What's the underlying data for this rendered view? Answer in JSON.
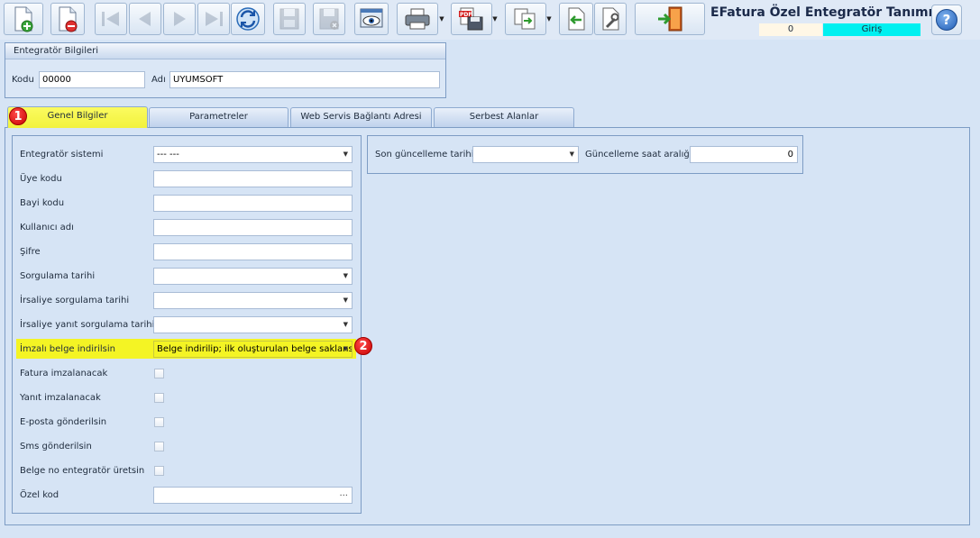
{
  "toolbar": {
    "buttons": [
      {
        "icon": "new-document-icon"
      },
      {
        "icon": "delete-document-icon"
      },
      {
        "icon": "first-record-icon"
      },
      {
        "icon": "previous-record-icon"
      },
      {
        "icon": "next-record-icon"
      },
      {
        "icon": "last-record-icon"
      },
      {
        "icon": "refresh-icon"
      },
      {
        "icon": "save-icon"
      },
      {
        "icon": "save-close-icon"
      },
      {
        "icon": "preview-icon"
      },
      {
        "icon": "print-icon"
      },
      {
        "icon": "pdf-export-icon"
      },
      {
        "icon": "copy-icon"
      },
      {
        "icon": "import-icon"
      },
      {
        "icon": "tools-icon"
      },
      {
        "icon": "exit-icon"
      }
    ],
    "title": "EFatura Özel Entegratör Tanımı",
    "record_count": "0",
    "mode": "Giriş",
    "mode_color": "#00f0f0"
  },
  "integrator_group": {
    "title": "Entegratör Bilgileri",
    "code_label": "Kodu",
    "code_value": "00000",
    "name_label": "Adı",
    "name_value": "UYUMSOFT"
  },
  "tabs": [
    {
      "label": "Genel Bilgiler",
      "active": true
    },
    {
      "label": "Parametreler",
      "active": false
    },
    {
      "label": "Web Servis Bağlantı Adresi",
      "active": false
    },
    {
      "label": "Serbest Alanlar",
      "active": false
    }
  ],
  "general": {
    "system_label": "Entegratör sistemi",
    "system_value": "--- ---",
    "member_code_label": "Üye kodu",
    "dealer_code_label": "Bayi kodu",
    "username_label": "Kullanıcı adı",
    "password_label": "Şifre",
    "query_date_label": "Sorgulama tarihi",
    "waybill_query_label": "İrsaliye sorgulama tarihi",
    "waybill_reply_label": "İrsaliye yanıt sorgulama tarihi",
    "signed_doc_label": "İmzalı belge indirilsin",
    "signed_doc_value": "Belge indirilip; ilk oluşturulan belge saklansın",
    "invoice_sign_label": "Fatura imzalanacak",
    "reply_sign_label": "Yanıt imzalanacak",
    "email_label": "E-posta gönderilsin",
    "sms_label": "Sms gönderilsin",
    "doc_no_label": "Belge no entegratör üretsin",
    "special_code_label": "Özel kod",
    "special_code_button": "..."
  },
  "update": {
    "last_update_label": "Son güncelleme tarihi",
    "interval_label": "Güncelleme saat aralığı",
    "interval_value": "0"
  },
  "badges": {
    "one": "1",
    "two": "2"
  },
  "highlight_color": "#f4f424"
}
